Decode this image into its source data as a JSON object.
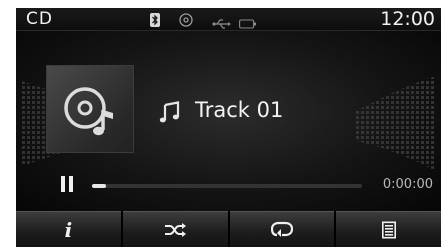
{
  "status_bar": {
    "source": "CD",
    "clock": "12:00",
    "icons": [
      "bluetooth-icon",
      "disc-icon",
      "usb-icon",
      "battery-icon"
    ]
  },
  "now_playing": {
    "album_art_icon": "cd-music-icon",
    "track_icon": "music-note-icon",
    "track_title": "Track 01"
  },
  "playback": {
    "state_icon": "pause-icon",
    "elapsed": "0:00:00",
    "progress_fraction": 0.05
  },
  "bottom_bar": {
    "buttons": [
      {
        "name": "info-button",
        "icon": "info-icon",
        "label": "i"
      },
      {
        "name": "shuffle-button",
        "icon": "shuffle-icon"
      },
      {
        "name": "repeat-button",
        "icon": "repeat-icon"
      },
      {
        "name": "list-button",
        "icon": "list-icon"
      }
    ]
  },
  "colors": {
    "background": "#0a0a0a",
    "text": "#f2f2f2",
    "accent": "#e6e6e6"
  }
}
